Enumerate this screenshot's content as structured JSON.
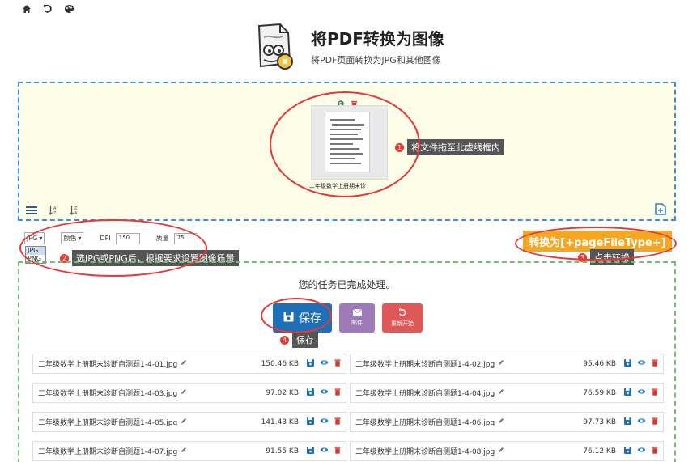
{
  "nav": {
    "icons": [
      "home-icon",
      "undo-icon",
      "palette-icon"
    ]
  },
  "header": {
    "title": "将PDF转换为图像",
    "subtitle": "将PDF页面转换为JPG和其他图像"
  },
  "dropzone": {
    "thumbnail_name": "二年级数学上册期末诊",
    "hint_number": "1",
    "hint_text": "将文件拖至此虚线框内"
  },
  "options": {
    "format_value": "JPG",
    "format_options": [
      "JPG",
      "PNG"
    ],
    "color_value": "颜色",
    "dpi_label": "DPI",
    "dpi_value": "150",
    "quality_label": "质量",
    "quality_value": "75",
    "hint_number": "2",
    "hint_text": "选JPG或PNG后，根据要求设置图像质量"
  },
  "convert": {
    "button_label": "转换为[+pageFileType+]",
    "hint_number": "3",
    "hint_text": "点击转换"
  },
  "results": {
    "done_message": "您的任务已完成处理。",
    "save_label": "保存",
    "mail_label": "邮件",
    "restart_label": "重新开始",
    "hint_number": "4",
    "hint_text": "保存",
    "files": [
      {
        "name": "二年级数学上册期末诊断自测题1-4-01.jpg",
        "size": "150.46 KB"
      },
      {
        "name": "二年级数学上册期末诊断自测题1-4-02.jpg",
        "size": "95.46 KB"
      },
      {
        "name": "二年级数学上册期末诊断自测题1-4-03.jpg",
        "size": "97.02 KB"
      },
      {
        "name": "二年级数学上册期末诊断自测题1-4-04.jpg",
        "size": "76.59 KB"
      },
      {
        "name": "二年级数学上册期末诊断自测题1-4-05.jpg",
        "size": "141.43 KB"
      },
      {
        "name": "二年级数学上册期末诊断自测题1-4-06.jpg",
        "size": "97.73 KB"
      },
      {
        "name": "二年级数学上册期末诊断自测题1-4-07.jpg",
        "size": "91.55 KB"
      },
      {
        "name": "二年级数学上册期末诊断自测题1-4-08.jpg",
        "size": "76.12 KB"
      }
    ]
  },
  "colors": {
    "accent_blue": "#1e6fb5",
    "convert_orange": "#f5a623",
    "annotation_red": "#e53935",
    "dropzone_bg": "#fefde8"
  }
}
